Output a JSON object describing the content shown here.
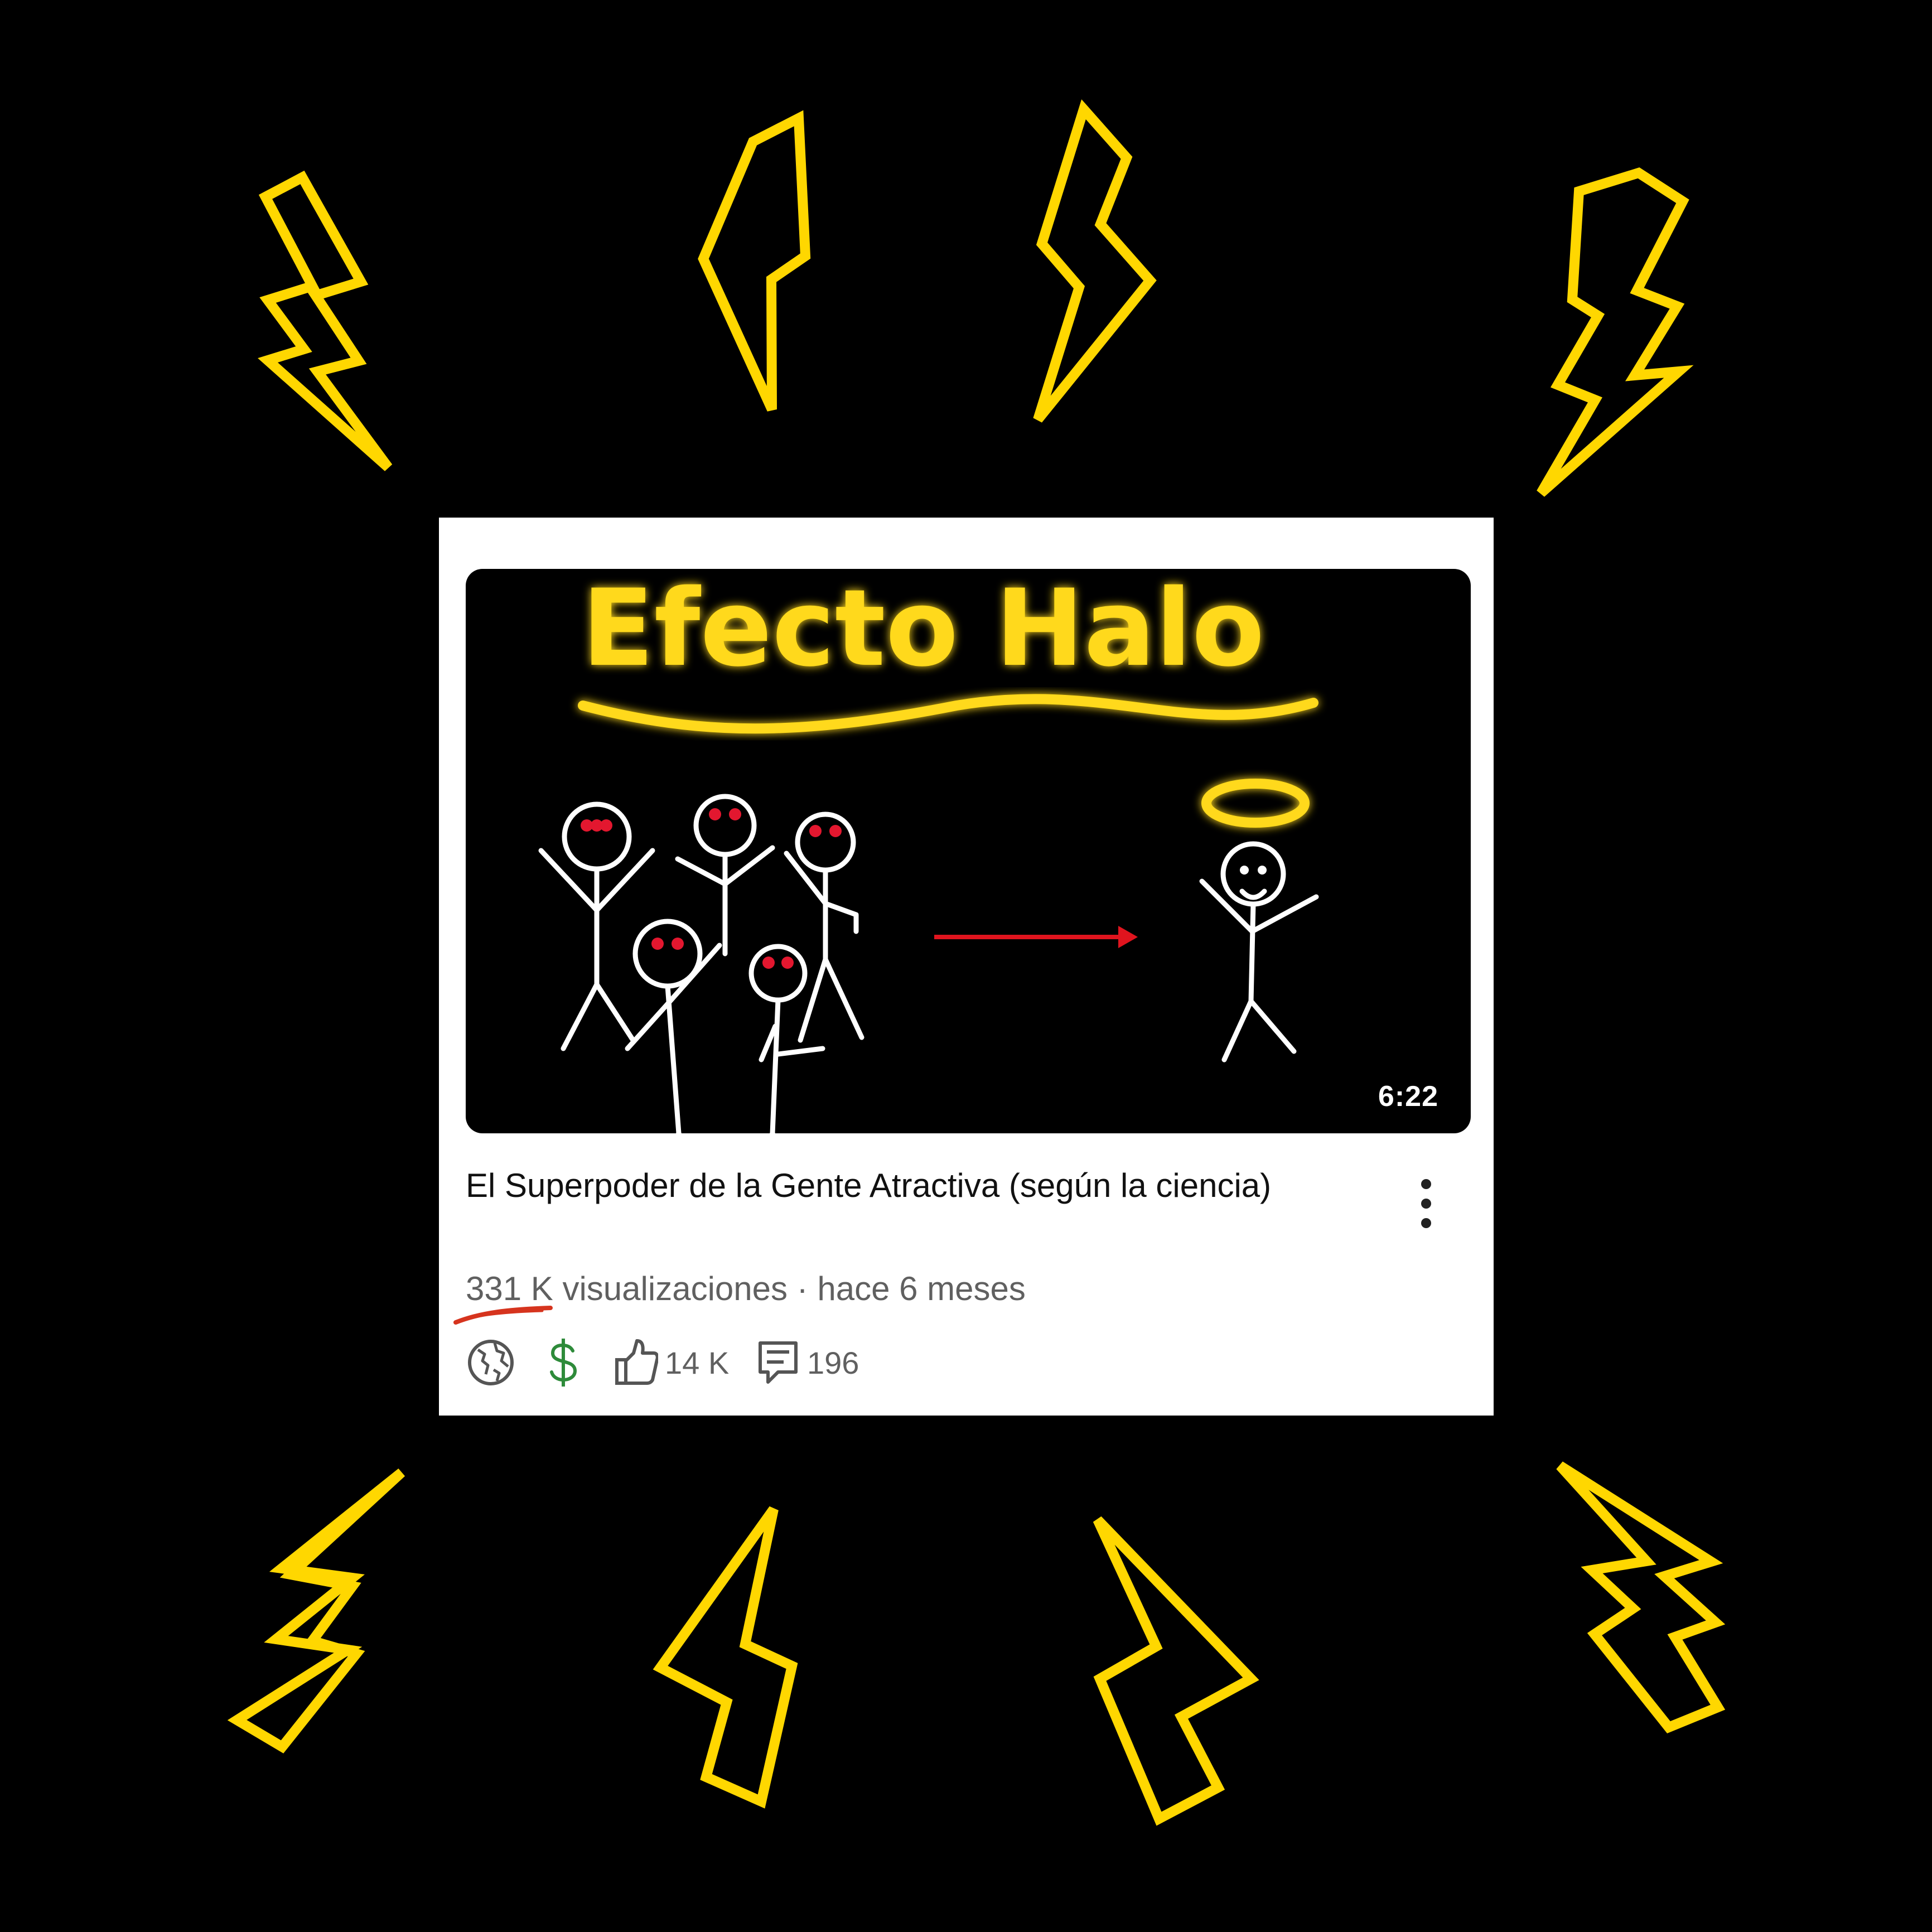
{
  "video": {
    "thumbnail_text": "Efecto Halo",
    "duration": "6:22",
    "title": "El Superpoder de la Gente Atractiva (según la ciencia)",
    "views": "331 K",
    "views_suffix": " visualizaciones",
    "separator": " · ",
    "age": "hace 6 meses",
    "likes": "14 K",
    "comments": "196"
  },
  "icons": {
    "visibility": "globe-icon",
    "monetization": "dollar-icon",
    "likes": "thumbs-up-icon",
    "comments": "comment-icon",
    "menu": "more-vert-icon"
  },
  "colors": {
    "background": "#000000",
    "bolt": "#ffd700",
    "neon_text": "#ffd91a",
    "arrow": "#e0141e",
    "underline": "#d6341e",
    "money": "#2e8b3a"
  }
}
